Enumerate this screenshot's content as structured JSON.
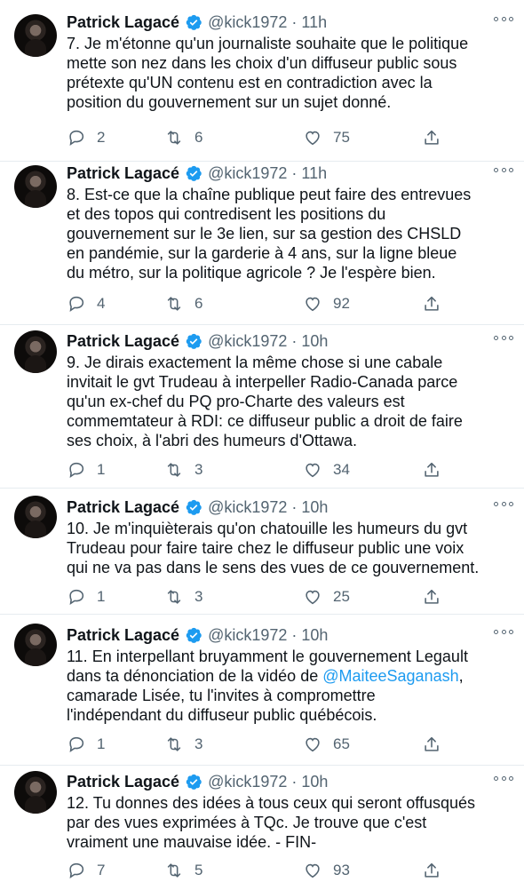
{
  "author": {
    "name": "Patrick Lagacé",
    "handle": "@kick1972"
  },
  "icons": {
    "verified": "verified-badge-icon",
    "more": "more-options-icon",
    "reply": "reply-icon",
    "retweet": "retweet-icon",
    "like": "heart-icon",
    "share": "share-icon"
  },
  "colors": {
    "verified": "#1d9bf0",
    "mention": "#1d9bf0",
    "muted": "#536471"
  },
  "tweets": [
    {
      "time": "11h",
      "text": "7. Je m'étonne qu'un journaliste souhaite que le politique\nmette son nez dans les choix d'un diffuseur public sous\nprétexte qu'UN contenu est en contradiction avec la\nposition du gouvernement sur un sujet donné.",
      "replies": "2",
      "retweets": "6",
      "likes": "75"
    },
    {
      "time": "11h",
      "text": "8. Est-ce que la chaîne publique peut faire des entrevues\net  des topos qui contredisent les positions du\ngouvernement sur le 3e lien, sur sa gestion des CHSLD\nen pandémie, sur la garderie à 4 ans, sur la ligne bleue\ndu métro, sur la politique agricole ? Je l'espère bien.",
      "replies": "4",
      "retweets": "6",
      "likes": "92"
    },
    {
      "time": "10h",
      "text": "9. Je dirais exactement la même chose si une cabale\ninvitait le gvt Trudeau à interpeller Radio-Canada parce\nqu'un ex-chef du PQ pro-Charte des valeurs est\ncommemtateur à RDI: ce diffuseur public a droit de faire\nses choix, à l'abri des humeurs d'Ottawa.",
      "replies": "1",
      "retweets": "3",
      "likes": "34"
    },
    {
      "time": "10h",
      "text": "10. Je m'inquièterais qu'on chatouille les humeurs du gvt\nTrudeau pour faire taire chez le diffuseur public une voix\nqui ne va pas dans le sens des vues de ce gouvernement.",
      "replies": "1",
      "retweets": "3",
      "likes": "25"
    },
    {
      "time": "10h",
      "text_before": "11. En interpellant bruyamment le gouvernement Legault\ndans ta dénonciation de la vidéo de ",
      "mention": "@MaiteeSaganash",
      "text_after": ",\ncamarade Lisée, tu l'invites à compromettre\nl'indépendant du diffuseur public québécois.",
      "replies": "1",
      "retweets": "3",
      "likes": "65"
    },
    {
      "time": "10h",
      "text": "12. Tu donnes des idées à tous ceux qui seront offusqués\npar des vues exprimées à TQc. Je trouve que c'est\nvraiment une mauvaise idée. - FIN-",
      "replies": "7",
      "retweets": "5",
      "likes": "93"
    }
  ]
}
